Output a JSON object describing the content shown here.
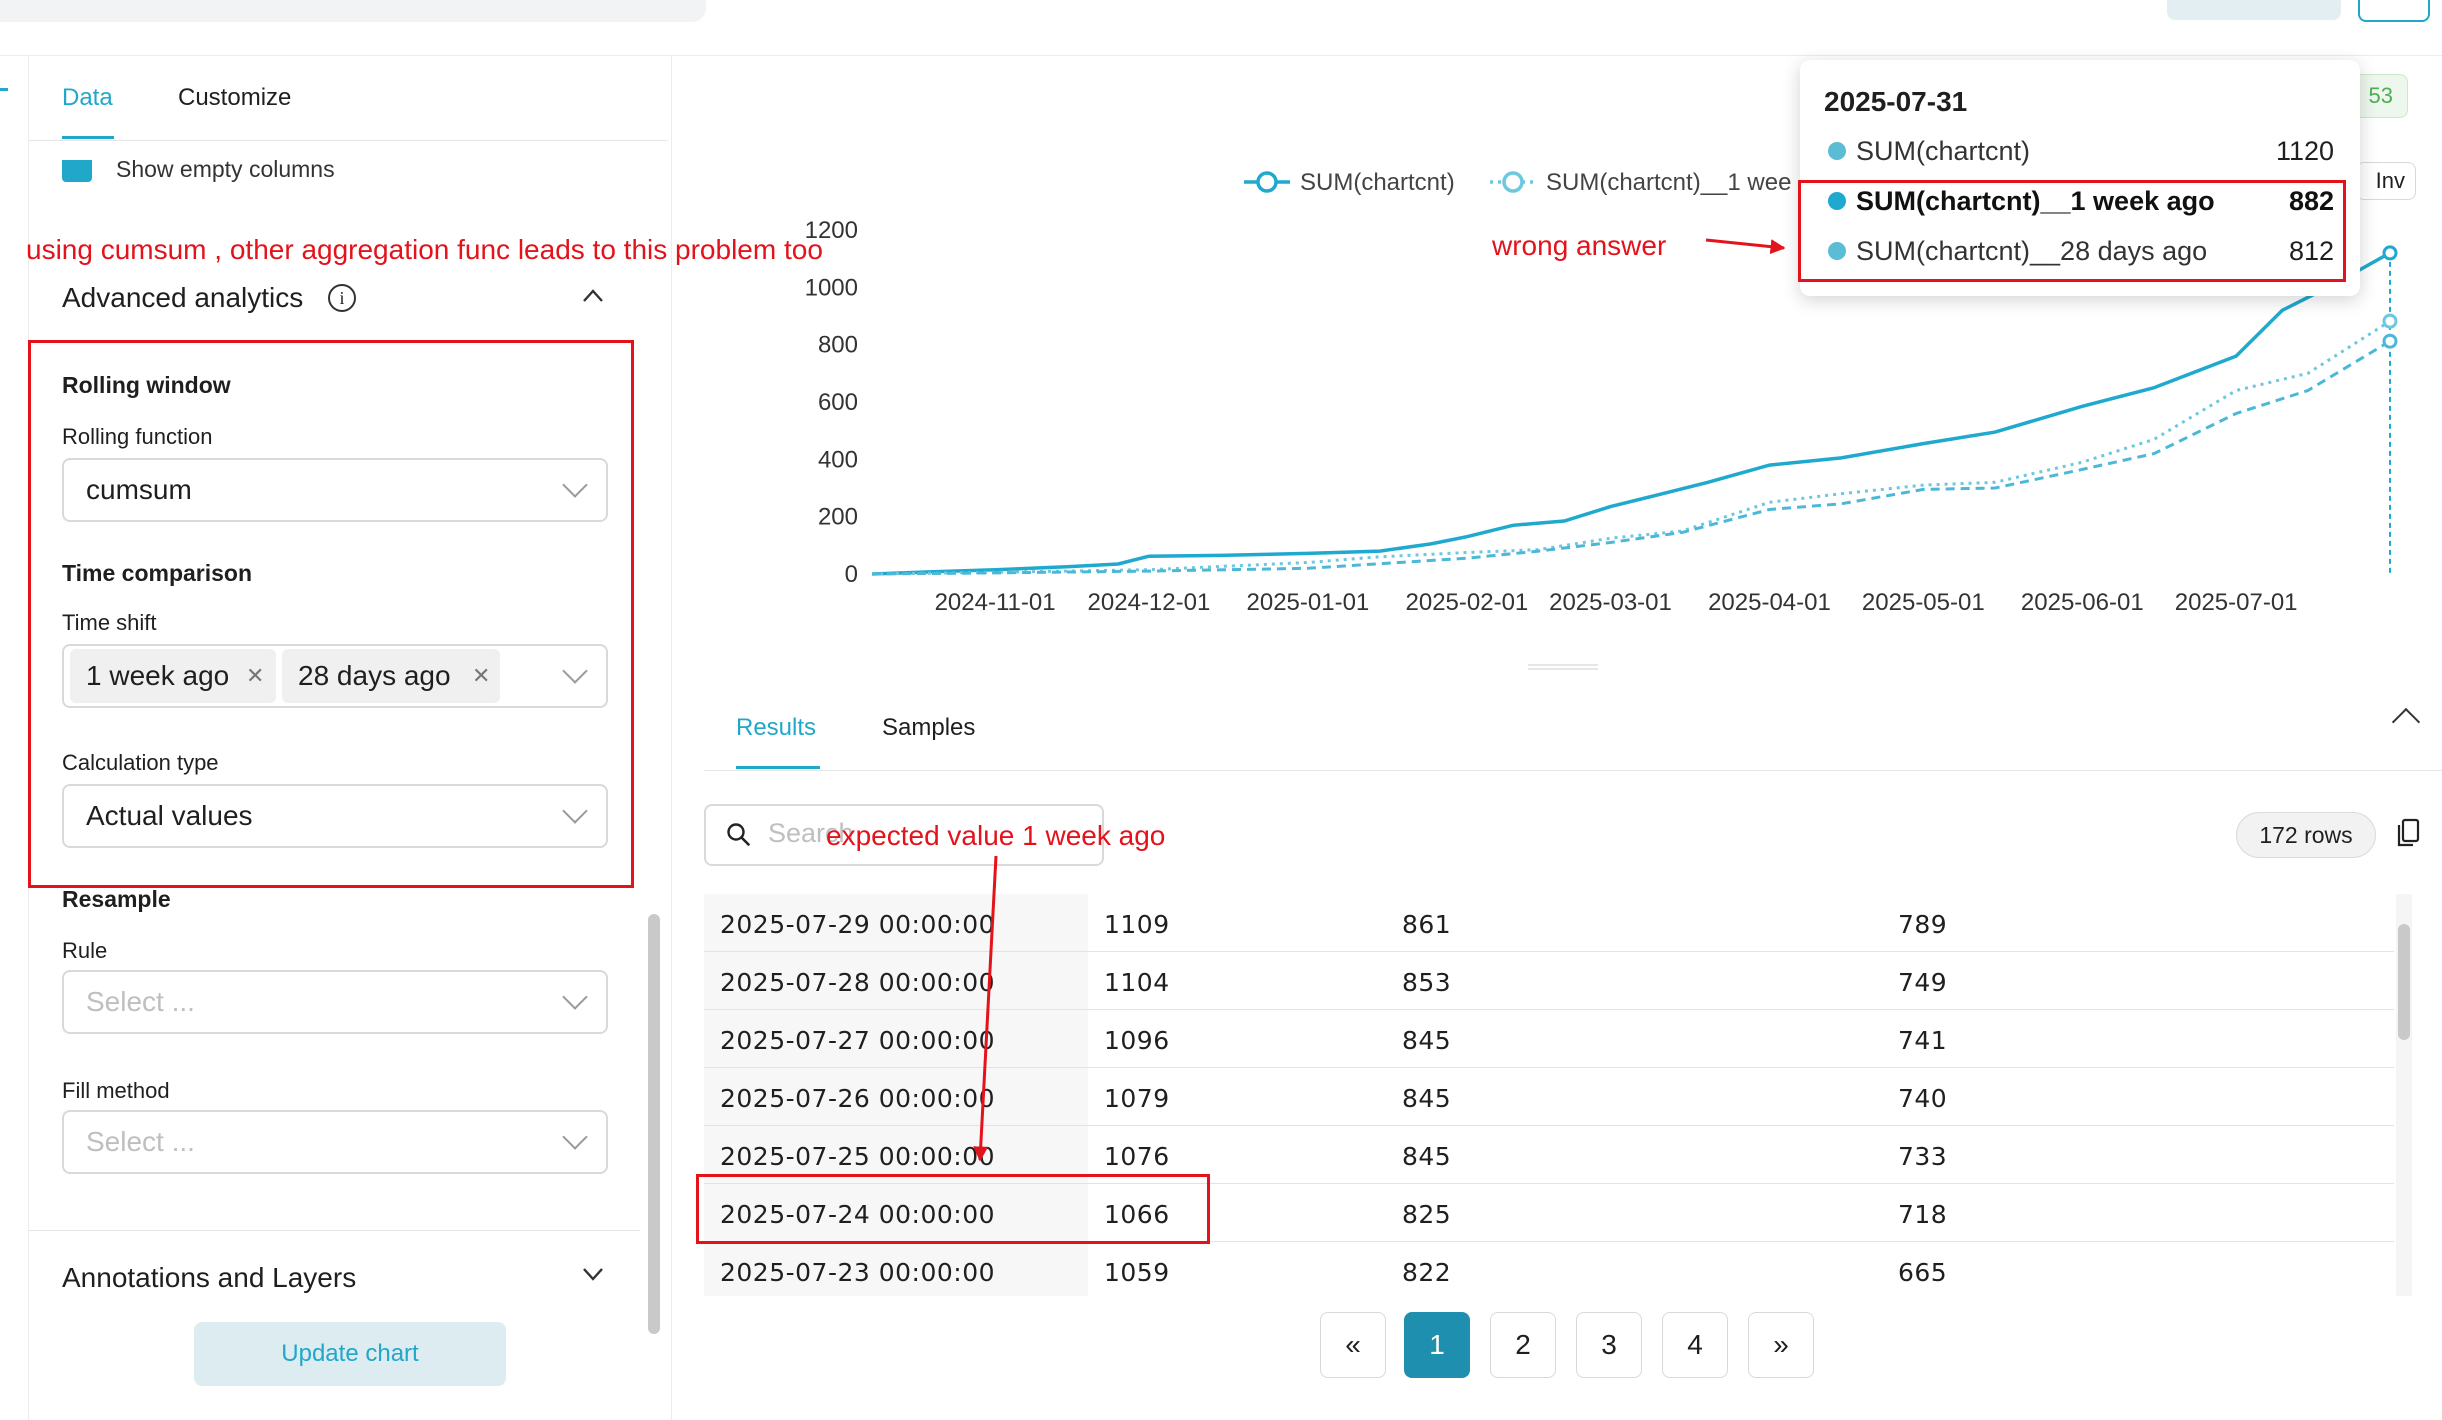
{
  "tabs": {
    "data": "Data",
    "customize": "Customize"
  },
  "show_empty_columns": "Show empty columns",
  "advanced_analytics": {
    "title": "Advanced analytics",
    "info_icon": "i",
    "rolling_window_heading": "Rolling window",
    "rolling_function_label": "Rolling function",
    "rolling_function_value": "cumsum",
    "time_comparison_heading": "Time comparison",
    "time_shift_label": "Time shift",
    "time_shift_tags": [
      "1 week ago",
      "28 days ago"
    ],
    "calculation_type_label": "Calculation type",
    "calculation_type_value": "Actual values",
    "resample_heading": "Resample",
    "rule_label": "Rule",
    "rule_placeholder": "Select ...",
    "fill_method_label": "Fill method",
    "fill_method_placeholder": "Select ..."
  },
  "annotations_title": "Annotations and Layers",
  "update_button": "Update chart",
  "badge_text": "53",
  "inv_button": "Inv",
  "chart_data": {
    "type": "line",
    "x_tick_labels": [
      "2024-11-01",
      "2024-12-01",
      "2025-01-01",
      "2025-02-01",
      "2025-03-01",
      "2025-04-01",
      "2025-05-01",
      "2025-06-01",
      "2025-07-01"
    ],
    "y_ticks": [
      0,
      200,
      400,
      600,
      800,
      1000,
      1200
    ],
    "ylim": [
      0,
      1200
    ],
    "legend_placement": "top",
    "series": [
      {
        "name": "SUM(chartcnt)",
        "legend_label": "SUM(chartcnt)",
        "color": "#1fa9cf",
        "style": "solid",
        "points": [
          [
            "2024-10-08",
            0
          ],
          [
            "2024-10-20",
            8
          ],
          [
            "2024-11-01",
            15
          ],
          [
            "2024-11-15",
            25
          ],
          [
            "2024-11-25",
            35
          ],
          [
            "2024-12-01",
            62
          ],
          [
            "2024-12-15",
            65
          ],
          [
            "2025-01-01",
            72
          ],
          [
            "2025-01-15",
            80
          ],
          [
            "2025-01-25",
            105
          ],
          [
            "2025-02-01",
            130
          ],
          [
            "2025-02-10",
            170
          ],
          [
            "2025-02-20",
            185
          ],
          [
            "2025-03-01",
            235
          ],
          [
            "2025-03-10",
            275
          ],
          [
            "2025-03-20",
            320
          ],
          [
            "2025-04-01",
            380
          ],
          [
            "2025-04-15",
            405
          ],
          [
            "2025-05-01",
            455
          ],
          [
            "2025-05-15",
            495
          ],
          [
            "2025-06-01",
            585
          ],
          [
            "2025-06-15",
            650
          ],
          [
            "2025-07-01",
            760
          ],
          [
            "2025-07-10",
            920
          ],
          [
            "2025-07-20",
            1010
          ],
          [
            "2025-07-31",
            1120
          ]
        ]
      },
      {
        "name": "SUM(chartcnt)__1 week ago",
        "legend_label": "SUM(chartcnt)__1 wee",
        "color": "#6cc7e0",
        "style": "dotted",
        "points": [
          [
            "2024-10-08",
            0
          ],
          [
            "2024-11-01",
            6
          ],
          [
            "2024-12-01",
            15
          ],
          [
            "2025-01-01",
            40
          ],
          [
            "2025-01-15",
            60
          ],
          [
            "2025-02-01",
            75
          ],
          [
            "2025-02-15",
            85
          ],
          [
            "2025-03-01",
            125
          ],
          [
            "2025-03-15",
            150
          ],
          [
            "2025-04-01",
            250
          ],
          [
            "2025-04-15",
            280
          ],
          [
            "2025-05-01",
            310
          ],
          [
            "2025-05-15",
            320
          ],
          [
            "2025-06-01",
            390
          ],
          [
            "2025-06-15",
            470
          ],
          [
            "2025-07-01",
            640
          ],
          [
            "2025-07-15",
            700
          ],
          [
            "2025-07-31",
            882
          ]
        ]
      },
      {
        "name": "SUM(chartcnt)__28 days ago",
        "legend_label": "",
        "color": "#4bb8d8",
        "style": "dashed",
        "points": [
          [
            "2024-10-08",
            0
          ],
          [
            "2024-11-01",
            4
          ],
          [
            "2024-12-01",
            10
          ],
          [
            "2025-01-01",
            20
          ],
          [
            "2025-02-01",
            55
          ],
          [
            "2025-02-15",
            80
          ],
          [
            "2025-03-01",
            110
          ],
          [
            "2025-03-15",
            145
          ],
          [
            "2025-04-01",
            225
          ],
          [
            "2025-04-15",
            245
          ],
          [
            "2025-05-01",
            295
          ],
          [
            "2025-05-15",
            300
          ],
          [
            "2025-06-01",
            365
          ],
          [
            "2025-06-15",
            420
          ],
          [
            "2025-07-01",
            560
          ],
          [
            "2025-07-15",
            640
          ],
          [
            "2025-07-31",
            812
          ]
        ]
      }
    ]
  },
  "tooltip": {
    "date": "2025-07-31",
    "rows": [
      {
        "label": "SUM(chartcnt)",
        "value": "1120",
        "color": "#5bbcd6",
        "bold": false
      },
      {
        "label": "SUM(chartcnt)__1 week ago",
        "value": "882",
        "color": "#1fa9cf",
        "bold": true
      },
      {
        "label": "SUM(chartcnt)__28 days ago",
        "value": "812",
        "color": "#5bbcd6",
        "bold": false
      }
    ]
  },
  "results": {
    "tab_results": "Results",
    "tab_samples": "Samples",
    "search_placeholder": "Search",
    "rows_badge": "172 rows",
    "rows": [
      [
        "2025-07-29 00:00:00",
        "1109",
        "861",
        "789"
      ],
      [
        "2025-07-28 00:00:00",
        "1104",
        "853",
        "749"
      ],
      [
        "2025-07-27 00:00:00",
        "1096",
        "845",
        "741"
      ],
      [
        "2025-07-26 00:00:00",
        "1079",
        "845",
        "740"
      ],
      [
        "2025-07-25 00:00:00",
        "1076",
        "845",
        "733"
      ],
      [
        "2025-07-24 00:00:00",
        "1066",
        "825",
        "718"
      ],
      [
        "2025-07-23 00:00:00",
        "1059",
        "822",
        "665"
      ]
    ],
    "pages": [
      "«",
      "1",
      "2",
      "3",
      "4",
      "»"
    ],
    "active_page": "1"
  },
  "annotations": {
    "cumsum_note": "using cumsum , other aggregation func leads to this problem too",
    "wrong_answer": "wrong answer",
    "expected_value": "expected value 1 week ago"
  },
  "colors": {
    "accent": "#20a7c9",
    "annotation_red": "#e3121b"
  }
}
